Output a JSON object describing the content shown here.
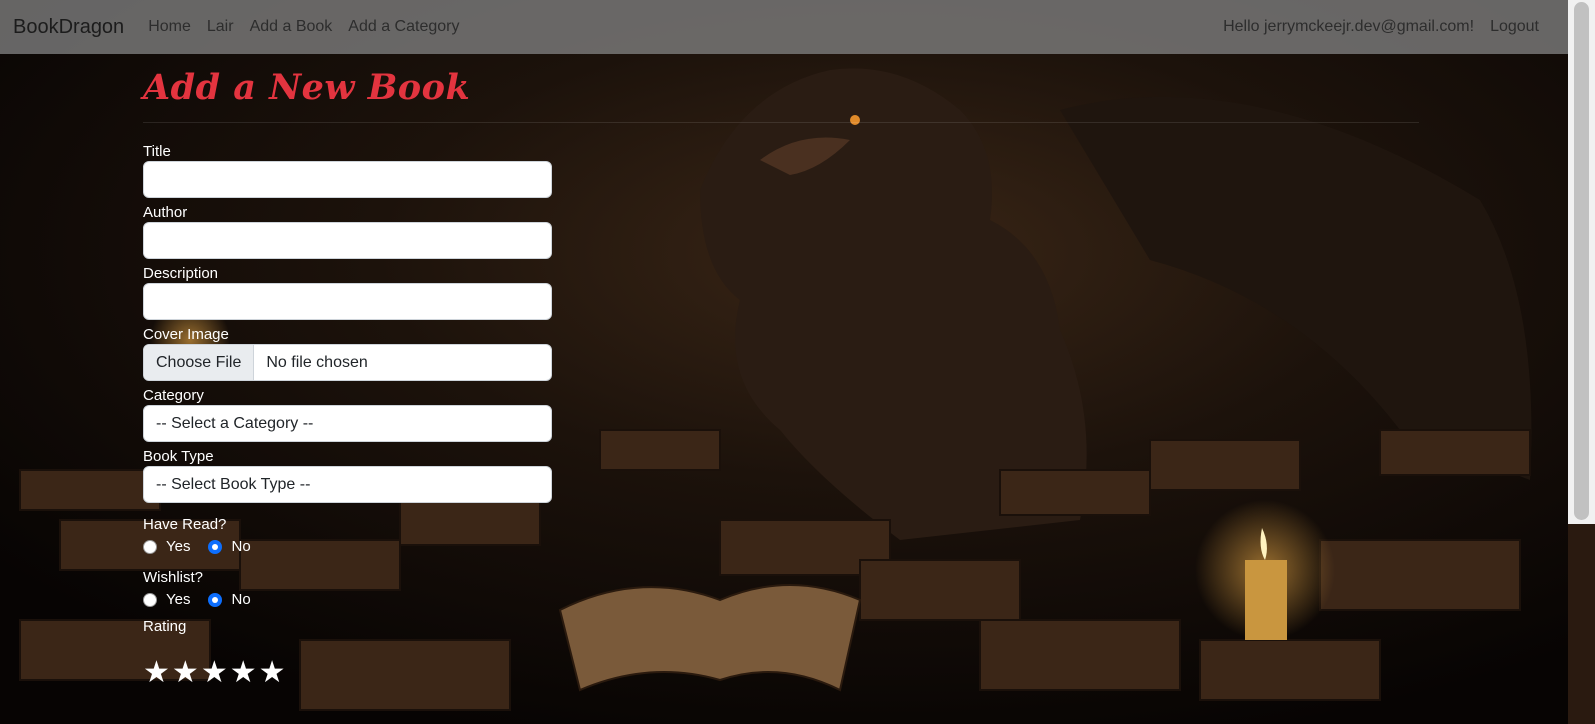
{
  "nav": {
    "brand": "BookDragon",
    "links": [
      "Home",
      "Lair",
      "Add a Book",
      "Add a Category"
    ],
    "greeting": "Hello jerrymckeejr.dev@gmail.com!",
    "logout": "Logout"
  },
  "page": {
    "title": "Add a New Book"
  },
  "form": {
    "title_label": "Title",
    "title_value": "",
    "author_label": "Author",
    "author_value": "",
    "description_label": "Description",
    "description_value": "",
    "cover_label": "Cover Image",
    "file_button": "Choose File",
    "file_status": "No file chosen",
    "category_label": "Category",
    "category_selected": "-- Select a Category --",
    "booktype_label": "Book Type",
    "booktype_selected": "-- Select Book Type --",
    "have_read_label": "Have Read?",
    "have_read_yes": "Yes",
    "have_read_no": "No",
    "have_read_value": "No",
    "wishlist_label": "Wishlist?",
    "wishlist_yes": "Yes",
    "wishlist_no": "No",
    "wishlist_value": "No",
    "rating_label": "Rating",
    "rating_value": 0,
    "rating_max": 5,
    "star_glyph": "★"
  },
  "colors": {
    "title": "#e3343f",
    "radio_checked": "#0d6efd",
    "navbar": "#808080"
  }
}
